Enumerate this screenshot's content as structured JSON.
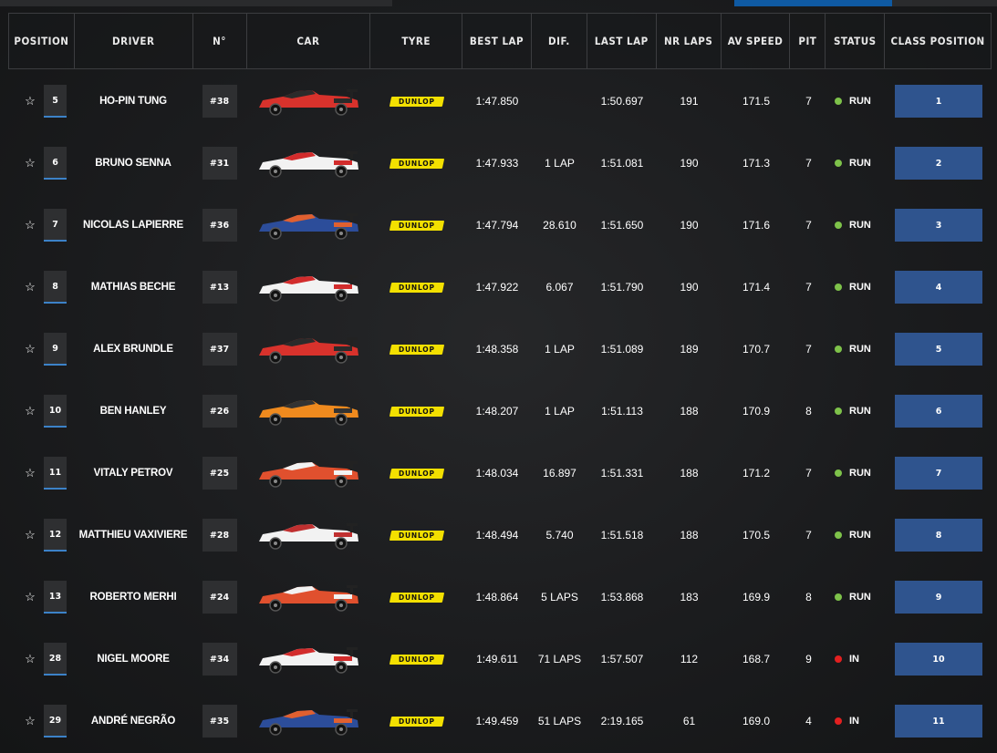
{
  "colors": {
    "accent": "#3c82c8",
    "class_box": "#2f548e",
    "status_run": "#7ec24a",
    "status_in": "#e32020",
    "tyre_brand": "#f3e000"
  },
  "header": {
    "position": "POSITION",
    "driver": "DRIVER",
    "number": "N°",
    "car": "CAR",
    "tyre": "TYRE",
    "best_lap": "BEST LAP",
    "dif": "DIF.",
    "last_lap": "LAST LAP",
    "nr_laps": "NR LAPS",
    "av_speed": "AV SPEED",
    "pit": "PIT",
    "status": "STATUS",
    "class_position": "CLASS POSITION"
  },
  "favorite_icon": "☆",
  "tyre_label": "DUNLOP",
  "rows": [
    {
      "position": "5",
      "driver": "HO-PIN TUNG",
      "number": "#38",
      "car_color": "#d8322c",
      "car_secondary": "#2b2b2b",
      "best_lap": "1:47.850",
      "dif": "",
      "last_lap": "1:50.697",
      "nr_laps": "191",
      "av_speed": "171.5",
      "pit": "7",
      "status": "RUN",
      "class_position": "1"
    },
    {
      "position": "6",
      "driver": "BRUNO SENNA",
      "number": "#31",
      "car_color": "#f2f2f2",
      "car_secondary": "#d22c2c",
      "best_lap": "1:47.933",
      "dif": "1 LAP",
      "last_lap": "1:51.081",
      "nr_laps": "190",
      "av_speed": "171.3",
      "pit": "7",
      "status": "RUN",
      "class_position": "2"
    },
    {
      "position": "7",
      "driver": "NICOLAS LAPIERRE",
      "number": "#36",
      "car_color": "#2c4d9a",
      "car_secondary": "#e06030",
      "best_lap": "1:47.794",
      "dif": "28.610",
      "last_lap": "1:51.650",
      "nr_laps": "190",
      "av_speed": "171.6",
      "pit": "7",
      "status": "RUN",
      "class_position": "3"
    },
    {
      "position": "8",
      "driver": "MATHIAS BECHE",
      "number": "#13",
      "car_color": "#f2f2f2",
      "car_secondary": "#d22c2c",
      "best_lap": "1:47.922",
      "dif": "6.067",
      "last_lap": "1:51.790",
      "nr_laps": "190",
      "av_speed": "171.4",
      "pit": "7",
      "status": "RUN",
      "class_position": "4"
    },
    {
      "position": "9",
      "driver": "ALEX BRUNDLE",
      "number": "#37",
      "car_color": "#d8322c",
      "car_secondary": "#2b2b2b",
      "best_lap": "1:48.358",
      "dif": "1 LAP",
      "last_lap": "1:51.089",
      "nr_laps": "189",
      "av_speed": "170.7",
      "pit": "7",
      "status": "RUN",
      "class_position": "5"
    },
    {
      "position": "10",
      "driver": "BEN HANLEY",
      "number": "#26",
      "car_color": "#ef8a1e",
      "car_secondary": "#333333",
      "best_lap": "1:48.207",
      "dif": "1 LAP",
      "last_lap": "1:51.113",
      "nr_laps": "188",
      "av_speed": "170.9",
      "pit": "8",
      "status": "RUN",
      "class_position": "6"
    },
    {
      "position": "11",
      "driver": "VITALY PETROV",
      "number": "#25",
      "car_color": "#e0502e",
      "car_secondary": "#f2f2f2",
      "best_lap": "1:48.034",
      "dif": "16.897",
      "last_lap": "1:51.331",
      "nr_laps": "188",
      "av_speed": "171.2",
      "pit": "7",
      "status": "RUN",
      "class_position": "7"
    },
    {
      "position": "12",
      "driver": "MATTHIEU VAXIVIERE",
      "number": "#28",
      "car_color": "#f2f2f2",
      "car_secondary": "#c03030",
      "best_lap": "1:48.494",
      "dif": "5.740",
      "last_lap": "1:51.518",
      "nr_laps": "188",
      "av_speed": "170.5",
      "pit": "7",
      "status": "RUN",
      "class_position": "8"
    },
    {
      "position": "13",
      "driver": "ROBERTO MERHI",
      "number": "#24",
      "car_color": "#e0502e",
      "car_secondary": "#f2f2f2",
      "best_lap": "1:48.864",
      "dif": "5 LAPS",
      "last_lap": "1:53.868",
      "nr_laps": "183",
      "av_speed": "169.9",
      "pit": "8",
      "status": "RUN",
      "class_position": "9"
    },
    {
      "position": "28",
      "driver": "NIGEL MOORE",
      "number": "#34",
      "car_color": "#f2f2f2",
      "car_secondary": "#d22c2c",
      "best_lap": "1:49.611",
      "dif": "71 LAPS",
      "last_lap": "1:57.507",
      "nr_laps": "112",
      "av_speed": "168.7",
      "pit": "9",
      "status": "IN",
      "class_position": "10"
    },
    {
      "position": "29",
      "driver": "ANDRÉ NEGRÃO",
      "number": "#35",
      "car_color": "#2c4d9a",
      "car_secondary": "#e06030",
      "best_lap": "1:49.459",
      "dif": "51 LAPS",
      "last_lap": "2:19.165",
      "nr_laps": "61",
      "av_speed": "169.0",
      "pit": "4",
      "status": "IN",
      "class_position": "11"
    }
  ]
}
